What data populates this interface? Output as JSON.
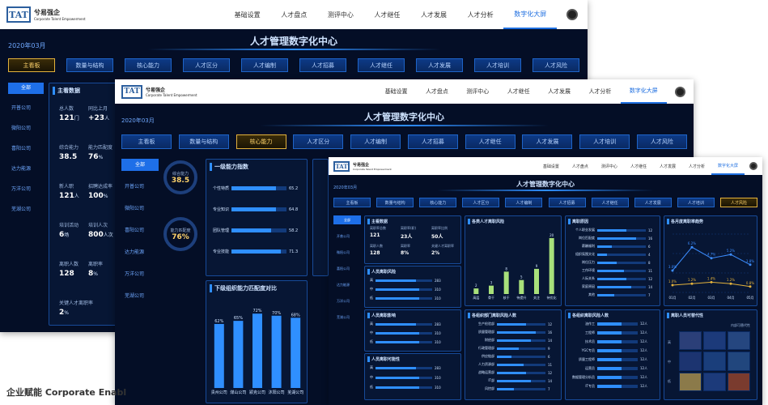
{
  "brand": {
    "name": "兮易强企",
    "sub": "Corporate Talent Empowerment"
  },
  "nav": [
    "基础设置",
    "人才盘点",
    "测评中心",
    "人才继任",
    "人才发展",
    "人才分析",
    "数字化大屏"
  ],
  "nav_active": "数字化大屏",
  "dash_title": "人才管理数字化中心",
  "date": "2020年03月",
  "tabs": [
    "主看板",
    "数量与结构",
    "核心能力",
    "人才区分",
    "人才编制",
    "人才招募",
    "人才继任",
    "人才发展",
    "人才培训",
    "人才风险"
  ],
  "companies": [
    "全部",
    "开普公司",
    "微阳公司",
    "喜阳公司",
    "达力能源",
    "万洋公司",
    "芜湖公司"
  ],
  "footer": "企业赋能  Corporate Enabl",
  "w1": {
    "active_tab": "主看板",
    "panel_title": "主看数据",
    "kpis": [
      {
        "label": "总人数",
        "value": "121",
        "unit": "门"
      },
      {
        "label": "同比上月",
        "value": "+23",
        "unit": "人"
      },
      {
        "label": "综合能力",
        "value": "38.5",
        "unit": ""
      },
      {
        "label": "能力匹配度",
        "value": "76",
        "unit": "%"
      },
      {
        "label": "新人职",
        "value": "121",
        "unit": "人"
      },
      {
        "label": "招聘达成率",
        "value": "100",
        "unit": "%"
      },
      {
        "label": "培训活动",
        "value": "6",
        "unit": "场"
      },
      {
        "label": "培训人次",
        "value": "800",
        "unit": "人次"
      },
      {
        "label": "离职人数",
        "value": "128",
        "unit": ""
      },
      {
        "label": "离职率",
        "value": "8",
        "unit": "%"
      },
      {
        "label": "关键人才离职率",
        "value": "2",
        "unit": "%"
      }
    ]
  },
  "w2": {
    "active_tab": "核心能力",
    "gauge1": {
      "label": "综合能力",
      "value": "38.5"
    },
    "gauge2": {
      "label": "能力匹配度",
      "value": "76%"
    },
    "panel1_title": "一级能力指数",
    "bars": [
      {
        "label": "个性特质",
        "value": 65.2
      },
      {
        "label": "专业知识",
        "value": 64.8
      },
      {
        "label": "团队管理",
        "value": 58.2
      },
      {
        "label": "专业技能",
        "value": 71.3
      }
    ],
    "bar_max": 80,
    "panel2_title": "下级组织能力匹配度对比",
    "chart_data": {
      "type": "bar",
      "title": "下级组织能力匹配度对比",
      "categories": [
        "贵州公司",
        "煤山公司",
        "颍克公司",
        "沐阳公司",
        "芜湖公司"
      ],
      "values": [
        62,
        65,
        72,
        70,
        68
      ],
      "value_labels": [
        "62%",
        "65%",
        "72%",
        "70%",
        "68%"
      ],
      "ylim": [
        0,
        80
      ]
    }
  },
  "w3": {
    "active_tab": "人才风险",
    "p1_title": "主看数据",
    "p1_items": [
      {
        "label": "离职率总数",
        "value": "121"
      },
      {
        "label": "离职率(职)",
        "value": "23人"
      },
      {
        "label": "离职率比例",
        "value": "50人"
      },
      {
        "label": "离职人数",
        "value": "128"
      },
      {
        "label": "离职率",
        "value": "8%"
      },
      {
        "label": "关键人才离职率",
        "value": "2%"
      }
    ],
    "p2_title": "人员离职风险",
    "p2_bars": [
      {
        "label": "高",
        "value": 283
      },
      {
        "label": "中",
        "value": 310
      },
      {
        "label": "低",
        "value": 310
      }
    ],
    "p3_title": "人员离职影响",
    "p3_bars": [
      {
        "label": "高",
        "value": 283
      },
      {
        "label": "中",
        "value": 310
      },
      {
        "label": "低",
        "value": 310
      }
    ],
    "p4_title": "人员离职可能性",
    "p4_bars": [
      {
        "label": "高",
        "value": 283
      },
      {
        "label": "中",
        "value": 310
      },
      {
        "label": "低",
        "value": 310
      }
    ],
    "p5_title": "各类人才离职风险",
    "chart_data": {
      "type": "bar",
      "title": "各类人才离职风险",
      "categories": [
        "高层",
        "骨干",
        "核干",
        "待提升",
        "关注",
        "待优化"
      ],
      "values": [
        2,
        3,
        8,
        5,
        9,
        20
      ]
    },
    "p6_title": "各组织部门离职风险人数",
    "p6_bars": [
      {
        "label": "生产检验部",
        "value": 12
      },
      {
        "label": "质量管理部",
        "value": 16
      },
      {
        "label": "财经部",
        "value": 14
      },
      {
        "label": "行政管理部",
        "value": 9
      },
      {
        "label": "供应链部",
        "value": 6
      },
      {
        "label": "人力资源部",
        "value": 11
      },
      {
        "label": "战略运营部",
        "value": 12
      },
      {
        "label": "IT部",
        "value": 14
      },
      {
        "label": "风控部",
        "value": 7
      }
    ],
    "p7_title": "离职原因",
    "p7_bars": [
      {
        "label": "个人职业发展",
        "value": 12
      },
      {
        "label": "岗位匹配度",
        "value": 16
      },
      {
        "label": "薪酬福利",
        "value": 6
      },
      {
        "label": "组织氛围文化",
        "value": 4
      },
      {
        "label": "岗位压力",
        "value": 8
      },
      {
        "label": "工作环境",
        "value": 11
      },
      {
        "label": "人际关系",
        "value": 12
      },
      {
        "label": "家庭原因",
        "value": 14
      },
      {
        "label": "其他",
        "value": 7
      }
    ],
    "p8_title": "各月度离职率趋势",
    "line_data": {
      "type": "line",
      "categories": [
        "01月",
        "02月",
        "03月",
        "04月",
        "05月"
      ],
      "series": [
        {
          "name": "",
          "values": [
            3.0,
            6.2,
            4.7,
            5.2,
            3.8
          ]
        },
        {
          "name": "",
          "values": [
            1.0,
            1.2,
            1.4,
            1.2,
            0.8
          ]
        }
      ],
      "labels_a": [
        "3.0%",
        "6.2%",
        "4.7%",
        "5.2%",
        "3.8%"
      ],
      "labels_b": [
        "1.0%",
        "1.2%",
        "1.4%",
        "1.2%",
        "0.8%"
      ]
    },
    "p9_title": "各组织离职风险人数",
    "p9_bars": [
      {
        "label": "油作工",
        "value": "12人"
      },
      {
        "label": "工程师",
        "value": "12人"
      },
      {
        "label": "技术员",
        "value": "12人"
      },
      {
        "label": "YGC专员",
        "value": "12人"
      },
      {
        "label": "质量工程师",
        "value": "12人"
      },
      {
        "label": "运营员",
        "value": "12人"
      },
      {
        "label": "数据管理分析员",
        "value": "12人"
      },
      {
        "label": "IT专员",
        "value": "12人"
      }
    ],
    "p10_title": "离职人员可替代性",
    "heat_colors": [
      "#2b3f78",
      "#1c3a7a",
      "#25467f",
      "#1c3470",
      "#1a3e7b",
      "#21467d",
      "#8b7a4a",
      "#1c3a7a",
      "#7a3b2e"
    ],
    "heat_row_labels": [
      "高",
      "中",
      "低"
    ],
    "heat_top_label": "内部可替代性"
  }
}
